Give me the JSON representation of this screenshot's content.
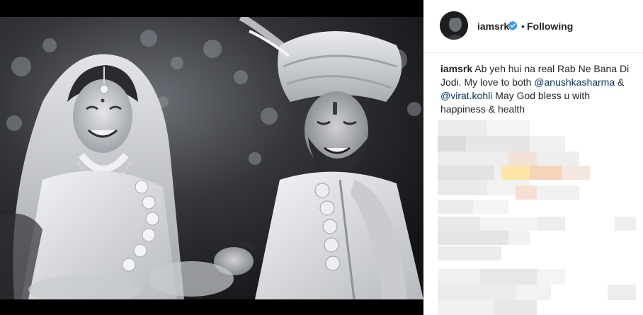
{
  "post": {
    "username": "iamsrk",
    "separator": "•",
    "follow_status": "Following",
    "caption": {
      "username": "iamsrk",
      "text_1": " Ab yeh hui na real Rab Ne Bana Di Jodi. My love to both ",
      "mention_1": "@anushkasharma",
      "text_2": " & ",
      "mention_2": "@virat.kohli",
      "text_3": " May God bless u with happiness & health"
    }
  },
  "icons": {
    "verified": "verified-badge-icon",
    "avatar": "profile-avatar"
  },
  "colors": {
    "verified_blue": "#3897f0",
    "mention_link": "#003569",
    "text": "#262626",
    "divider": "#efefef"
  }
}
